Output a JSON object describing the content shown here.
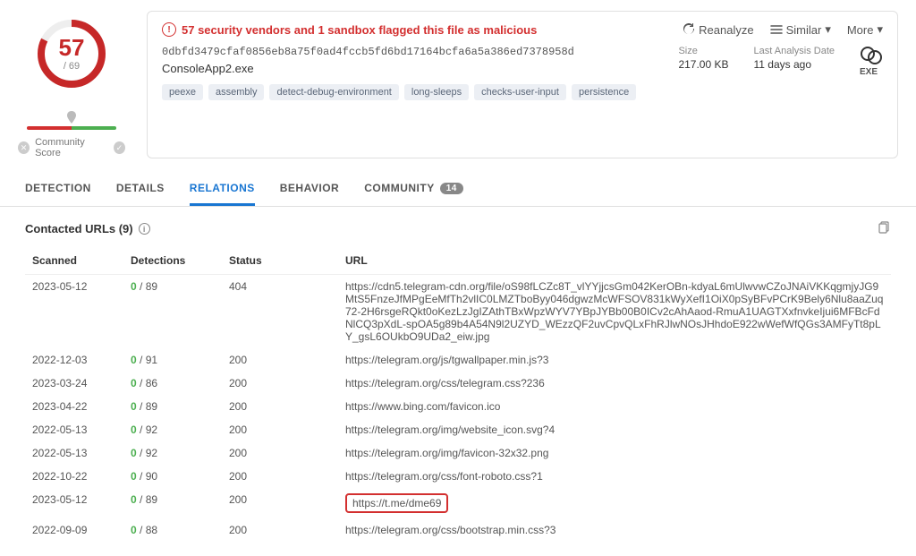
{
  "score": {
    "flagged": "57",
    "total": "/ 69"
  },
  "community_label": "Community Score",
  "alert": "57 security vendors and 1 sandbox flagged this file as malicious",
  "actions": {
    "reanalyze": "Reanalyze",
    "similar": "Similar",
    "more": "More"
  },
  "file": {
    "hash": "0dbfd3479cfaf0856eb8a75f0ad4fccb5fd6bd17164bcfa6a5a386ed7378958d",
    "name": "ConsoleApp2.exe",
    "tags": [
      "peexe",
      "assembly",
      "detect-debug-environment",
      "long-sleeps",
      "checks-user-input",
      "persistence"
    ]
  },
  "stats": {
    "size_label": "Size",
    "size_value": "217.00 KB",
    "date_label": "Last Analysis Date",
    "date_value": "11 days ago",
    "type_label": "EXE"
  },
  "tabs": {
    "detection": "DETECTION",
    "details": "DETAILS",
    "relations": "RELATIONS",
    "behavior": "BEHAVIOR",
    "community": "COMMUNITY",
    "community_count": "14"
  },
  "section": {
    "title": "Contacted URLs  (9)"
  },
  "columns": {
    "scanned": "Scanned",
    "detections": "Detections",
    "status": "Status",
    "url": "URL"
  },
  "rows": [
    {
      "scanned": "2023-05-12",
      "det_ok": "0",
      "det_tot": " / 89",
      "status": "404",
      "url": "https://cdn5.telegram-cdn.org/file/oS98fLCZc8T_vlYYjjcsGm042KerOBn-kdyaL6mUlwvwCZoJNAiVKKqgmjyJG9MtS5FnzeJfMPgEeMfTh2vlIC0LMZTboByy046dgwzMcWFSOV831kWyXefI1OiX0pSyBFvPCrK9Bely6Nlu8aaZuq72-2H6rsgeRQkt0oKezLzJgIZAthTBxWpzWYV7YBpJYBb00B0ICv2cAhAaod-RmuA1UAGTXxfnvkeIjui6MFBcFdNlCQ3pXdL-spOA5g89b4A54N9l2UZYD_WEzzQF2uvCpvQLxFhRJlwNOsJHhdoE922wWefWfQGs3AMFyTt8pLY_gsL6OUkbO9UDa2_eiw.jpg",
      "hl": false
    },
    {
      "scanned": "2022-12-03",
      "det_ok": "0",
      "det_tot": " / 91",
      "status": "200",
      "url": "https://telegram.org/js/tgwallpaper.min.js?3",
      "hl": false
    },
    {
      "scanned": "2023-03-24",
      "det_ok": "0",
      "det_tot": " / 86",
      "status": "200",
      "url": "https://telegram.org/css/telegram.css?236",
      "hl": false
    },
    {
      "scanned": "2023-04-22",
      "det_ok": "0",
      "det_tot": " / 89",
      "status": "200",
      "url": "https://www.bing.com/favicon.ico",
      "hl": false
    },
    {
      "scanned": "2022-05-13",
      "det_ok": "0",
      "det_tot": " / 92",
      "status": "200",
      "url": "https://telegram.org/img/website_icon.svg?4",
      "hl": false
    },
    {
      "scanned": "2022-05-13",
      "det_ok": "0",
      "det_tot": " / 92",
      "status": "200",
      "url": "https://telegram.org/img/favicon-32x32.png",
      "hl": false
    },
    {
      "scanned": "2022-10-22",
      "det_ok": "0",
      "det_tot": " / 90",
      "status": "200",
      "url": "https://telegram.org/css/font-roboto.css?1",
      "hl": false
    },
    {
      "scanned": "2023-05-12",
      "det_ok": "0",
      "det_tot": " / 89",
      "status": "200",
      "url": "https://t.me/dme69",
      "hl": true
    },
    {
      "scanned": "2022-09-09",
      "det_ok": "0",
      "det_tot": " / 88",
      "status": "200",
      "url": "https://telegram.org/css/bootstrap.min.css?3",
      "hl": false
    }
  ]
}
